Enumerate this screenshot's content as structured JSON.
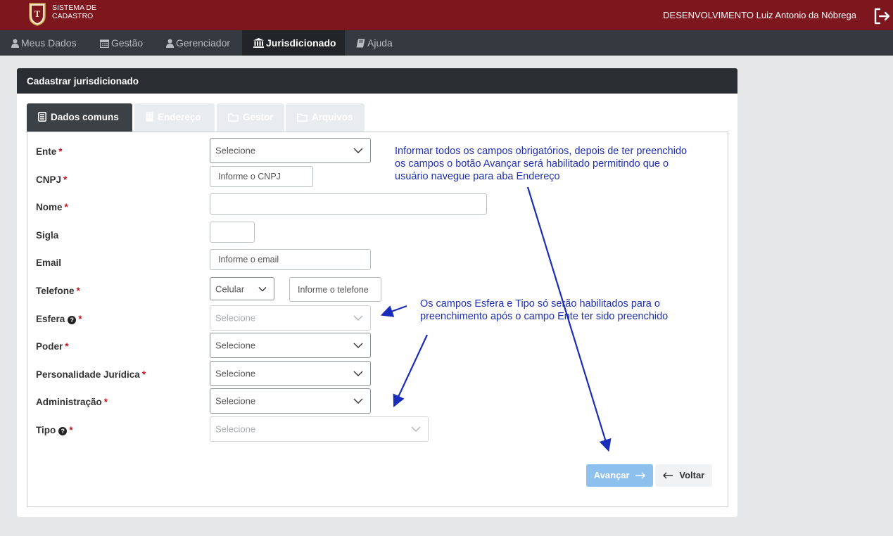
{
  "header": {
    "brand_line1": "SISTEMA DE",
    "brand_line2": "CADASTRO",
    "user": "DESENVOLVIMENTO Luiz Antonio da Nóbrega",
    "brand_color": "#7e161d"
  },
  "nav": {
    "items": [
      {
        "label": "Meus Dados",
        "icon": "user-icon"
      },
      {
        "label": "Gestão",
        "icon": "calendar-icon"
      },
      {
        "label": "Gerenciador",
        "icon": "user-icon"
      },
      {
        "label": "Jurisdicionado",
        "icon": "bank-icon",
        "active": true
      },
      {
        "label": "Ajuda",
        "icon": "book-icon"
      }
    ]
  },
  "card": {
    "title": "Cadastrar jurisdicionado",
    "tabs": [
      {
        "label": "Dados comuns",
        "icon": "document-icon",
        "state": "active"
      },
      {
        "label": "Endereço",
        "icon": "building-icon",
        "state": "disabled"
      },
      {
        "label": "Gestor",
        "icon": "folder-icon",
        "state": "disabled"
      },
      {
        "label": "Arquivos",
        "icon": "folder-icon",
        "state": "disabled"
      }
    ]
  },
  "form": {
    "ente": {
      "label": "Ente",
      "value": "Selecione"
    },
    "cnpj": {
      "label": "CNPJ",
      "placeholder": "Informe o CNPJ"
    },
    "nome": {
      "label": "Nome",
      "value": ""
    },
    "sigla": {
      "label": "Sigla",
      "value": ""
    },
    "email": {
      "label": "Email",
      "placeholder": "Informe o email"
    },
    "telefone": {
      "label": "Telefone",
      "type_value": "Celular",
      "placeholder": "Informe o telefone"
    },
    "esfera": {
      "label": "Esfera",
      "value": "Selecione",
      "disabled": true
    },
    "poder": {
      "label": "Poder",
      "value": "Selecione"
    },
    "personalidade": {
      "label": "Personalidade Jurídica",
      "value": "Selecione"
    },
    "administracao": {
      "label": "Administração",
      "value": "Selecione"
    },
    "tipo": {
      "label": "Tipo",
      "value": "Selecione",
      "disabled": true
    }
  },
  "buttons": {
    "next": "Avançar",
    "back": "Voltar"
  },
  "annotations": {
    "note1_line1": "Informar todos os campos obrigatórios, depois de ter preenchido",
    "note1_line2": "os campos o botão Avançar será habilitado permitindo que o",
    "note1_line3": "usuário navegue para aba Endereço",
    "note2_line1": "Os campos Esfera e Tipo só serão habilitados para o",
    "note2_line2": "preenchimento após o campo Ente ter sido preenchido",
    "arrow_color": "#1a2db8"
  }
}
